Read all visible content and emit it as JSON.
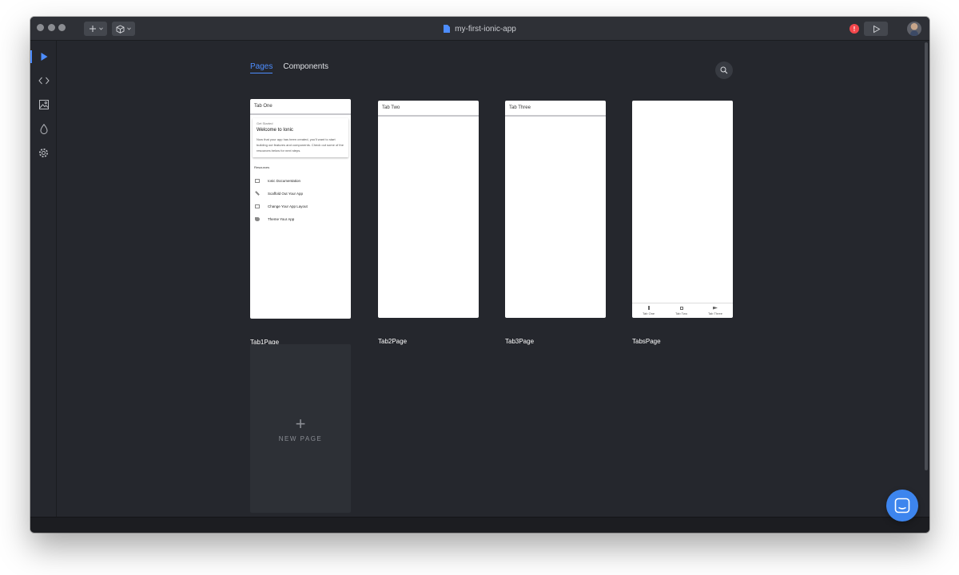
{
  "window": {
    "title": "my-first-ionic-app",
    "alert_count": "!"
  },
  "toolbar": {
    "new_icon": "plus-icon",
    "package_icon": "cube-icon",
    "run_icon": "play-icon"
  },
  "sidebar": {
    "items": [
      {
        "name": "design",
        "icon": "play-icon",
        "active": true
      },
      {
        "name": "code",
        "icon": "code-icon"
      },
      {
        "name": "assets",
        "icon": "image-icon"
      },
      {
        "name": "theme",
        "icon": "droplet-icon"
      },
      {
        "name": "settings",
        "icon": "gear-icon"
      }
    ]
  },
  "main": {
    "tabs": [
      {
        "label": "Pages",
        "active": true
      },
      {
        "label": "Components",
        "active": false
      }
    ],
    "pages": [
      {
        "name": "Tab1Page",
        "header": "Tab One",
        "card_subtitle": "Get Started",
        "card_title": "Welcome to Ionic",
        "card_body": "Now that your app has been created, you'll want to start building out features and components. Check out some of the resources below for next steps.",
        "resources_label": "Resources",
        "resources": [
          "Ionic Documentation",
          "Scaffold Out Your App",
          "Change Your App Layout",
          "Theme Your App"
        ]
      },
      {
        "name": "Tab2Page",
        "header": "Tab Two"
      },
      {
        "name": "Tab3Page",
        "header": "Tab Three"
      },
      {
        "name": "TabsPage",
        "tabbar": [
          "Tab One",
          "Tab Two",
          "Tab Three"
        ]
      }
    ],
    "new_page_label": "NEW PAGE"
  },
  "colors": {
    "accent": "#4d8dff",
    "background": "#25272d",
    "alert": "#f4474c",
    "chat": "#3d85ee"
  }
}
